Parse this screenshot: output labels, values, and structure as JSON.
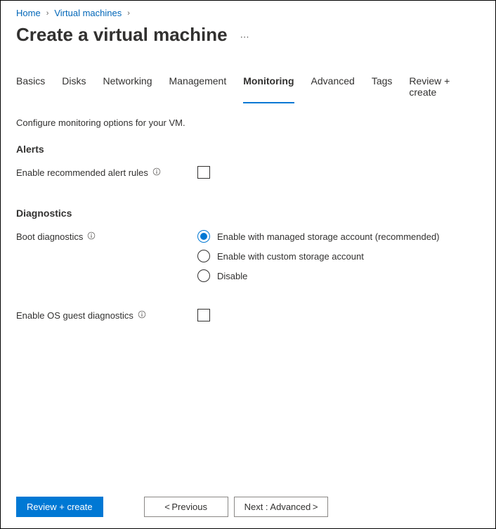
{
  "breadcrumb": {
    "home": "Home",
    "vms": "Virtual machines"
  },
  "page_title": "Create a virtual machine",
  "tabs": [
    {
      "label": "Basics",
      "active": false
    },
    {
      "label": "Disks",
      "active": false
    },
    {
      "label": "Networking",
      "active": false
    },
    {
      "label": "Management",
      "active": false
    },
    {
      "label": "Monitoring",
      "active": true
    },
    {
      "label": "Advanced",
      "active": false
    },
    {
      "label": "Tags",
      "active": false
    },
    {
      "label": "Review + create",
      "active": false
    }
  ],
  "description": "Configure monitoring options for your VM.",
  "sections": {
    "alerts": {
      "heading": "Alerts",
      "enable_recommended_label": "Enable recommended alert rules"
    },
    "diagnostics": {
      "heading": "Diagnostics",
      "boot_diagnostics_label": "Boot diagnostics",
      "boot_options": [
        {
          "label": "Enable with managed storage account (recommended)",
          "selected": true
        },
        {
          "label": "Enable with custom storage account",
          "selected": false
        },
        {
          "label": "Disable",
          "selected": false
        }
      ],
      "enable_os_guest_label": "Enable OS guest diagnostics"
    }
  },
  "footer": {
    "review_create": "Review + create",
    "previous": "< Previous",
    "next": "Next : Advanced >"
  }
}
